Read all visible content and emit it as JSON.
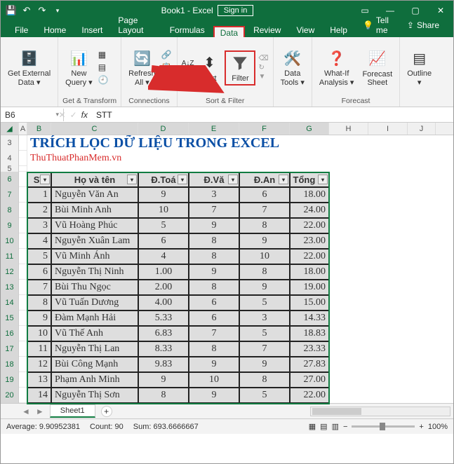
{
  "window": {
    "title": "Book1 - Excel",
    "signin": "Sign in"
  },
  "tabs": {
    "file": "File",
    "home": "Home",
    "insert": "Insert",
    "page_layout": "Page Layout",
    "formulas": "Formulas",
    "data": "Data",
    "review": "Review",
    "view": "View",
    "help": "Help",
    "tellme": "Tell me",
    "share": "Share"
  },
  "ribbon": {
    "get_external": "Get External\nData ▾",
    "new_query": "New\nQuery ▾",
    "refresh_all": "Refresh\nAll ▾",
    "sort": "Sort",
    "filter": "Filter",
    "data_tools": "Data\nTools ▾",
    "whatif": "What-If\nAnalysis ▾",
    "forecast_sheet": "Forecast\nSheet",
    "outline": "Outline\n▾",
    "grp_transform": "Get & Transform",
    "grp_connections": "Connections",
    "grp_sortfilter": "Sort & Filter",
    "grp_forecast": "Forecast"
  },
  "name_box": "B6",
  "formula": "STT",
  "sheet": {
    "title": "TRÍCH LỌC DỮ LIỆU TRONG EXCEL",
    "subtitle": "ThuThuatPhanMem.vn",
    "headers": {
      "stt": "ST",
      "name": "Họ và tên",
      "toan": "Đ.Toá",
      "van": "Đ.Vă",
      "anh": "Đ.An",
      "tong": "Tổng đi"
    },
    "rows": [
      {
        "stt": "1",
        "name": "Nguyễn Văn An",
        "toan": "9",
        "van": "3",
        "anh": "6",
        "tong": "18.00"
      },
      {
        "stt": "2",
        "name": "Bùi Minh Anh",
        "toan": "10",
        "van": "7",
        "anh": "7",
        "tong": "24.00"
      },
      {
        "stt": "3",
        "name": "Vũ Hoàng Phúc",
        "toan": "5",
        "van": "9",
        "anh": "8",
        "tong": "22.00"
      },
      {
        "stt": "4",
        "name": "Nguyễn Xuân Lam",
        "toan": "6",
        "van": "8",
        "anh": "9",
        "tong": "23.00"
      },
      {
        "stt": "5",
        "name": "Vũ Minh Ánh",
        "toan": "4",
        "van": "8",
        "anh": "10",
        "tong": "22.00"
      },
      {
        "stt": "6",
        "name": "Nguyễn Thị Ninh",
        "toan": "1.00",
        "van": "9",
        "anh": "8",
        "tong": "18.00"
      },
      {
        "stt": "7",
        "name": "Bùi Thu Ngọc",
        "toan": "2.00",
        "van": "8",
        "anh": "9",
        "tong": "19.00"
      },
      {
        "stt": "8",
        "name": "Vũ Tuấn Dương",
        "toan": "4.00",
        "van": "6",
        "anh": "5",
        "tong": "15.00"
      },
      {
        "stt": "9",
        "name": "Đàm Mạnh Hải",
        "toan": "5.33",
        "van": "6",
        "anh": "3",
        "tong": "14.33"
      },
      {
        "stt": "10",
        "name": "Vũ Thế Anh",
        "toan": "6.83",
        "van": "7",
        "anh": "5",
        "tong": "18.83"
      },
      {
        "stt": "11",
        "name": "Nguyễn Thị Lan",
        "toan": "8.33",
        "van": "8",
        "anh": "7",
        "tong": "23.33"
      },
      {
        "stt": "12",
        "name": "Bùi Công Mạnh",
        "toan": "9.83",
        "van": "9",
        "anh": "9",
        "tong": "27.83"
      },
      {
        "stt": "13",
        "name": "Phạm Anh Minh",
        "toan": "9",
        "van": "10",
        "anh": "8",
        "tong": "27.00"
      },
      {
        "stt": "14",
        "name": "Nguyễn Thị Sơn",
        "toan": "8",
        "van": "9",
        "anh": "5",
        "tong": "22.00"
      }
    ],
    "tab_name": "Sheet1"
  },
  "status": {
    "average_lbl": "Average:",
    "average": "9.90952381",
    "count_lbl": "Count:",
    "count": "90",
    "sum_lbl": "Sum:",
    "sum": "693.6666667",
    "zoom": "100%"
  }
}
